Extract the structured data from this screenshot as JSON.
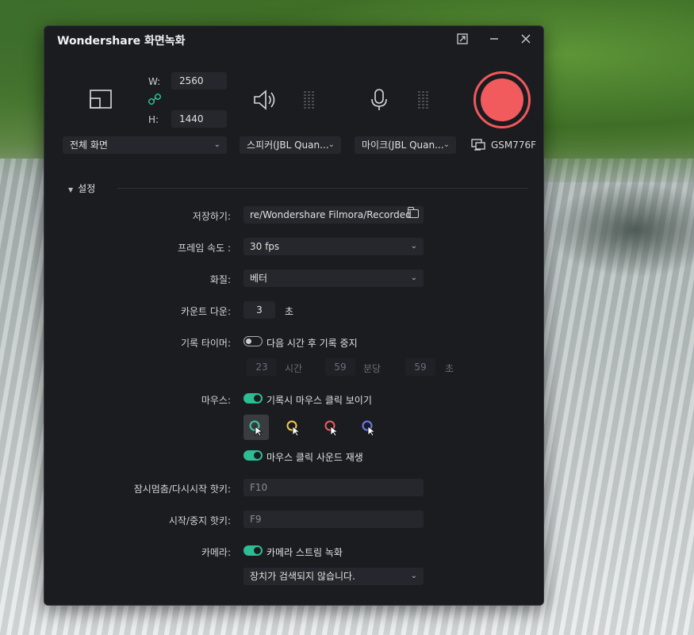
{
  "window": {
    "title": "Wondershare 화면녹화"
  },
  "capture": {
    "w_label": "W:",
    "w_value": "2560",
    "h_label": "H:",
    "h_value": "1440",
    "mode": "전체 화면"
  },
  "audio": {
    "speaker": "스피커(JBL Quan...",
    "mic": "마이크(JBL Quan..."
  },
  "monitor": {
    "label": "GSM776F"
  },
  "colors": {
    "accent": "#2dbd95",
    "record": "#f25b5e"
  },
  "settings": {
    "header": "설정",
    "save": {
      "label": "저장하기:",
      "value": "re/Wondershare Filmora/Recorded"
    },
    "fps": {
      "label": "프레임 속도 :",
      "value": "30 fps"
    },
    "quality": {
      "label": "화질:",
      "value": "베터"
    },
    "countdown": {
      "label": "카운트 다운:",
      "value": "3",
      "unit": "초"
    },
    "timer": {
      "label": "기록 타이머:",
      "toggle_text": "다음 시간 후 기록 중지",
      "enabled": false,
      "hours": "23",
      "hours_unit": "시간",
      "minutes": "59",
      "minutes_unit": "분당",
      "seconds": "59",
      "seconds_unit": "초"
    },
    "mouse": {
      "label": "마우스:",
      "show_clicks": "기록시 마우스 클릭 보이기",
      "click_sound": "마우스 클릭 사운드 재생",
      "cursor_colors": [
        "#3ec7a0",
        "#f2c94c",
        "#f25b5e",
        "#6c7cf0"
      ]
    },
    "pause_hotkey": {
      "label": "잠시멈춤/다시시작 핫키:",
      "value": "F10"
    },
    "start_hotkey": {
      "label": "시작/중지 핫키:",
      "value": "F9"
    },
    "camera": {
      "label": "카메라:",
      "toggle_text": "카메라 스트림 녹화",
      "device": "장치가 검색되지 않습니다."
    }
  }
}
